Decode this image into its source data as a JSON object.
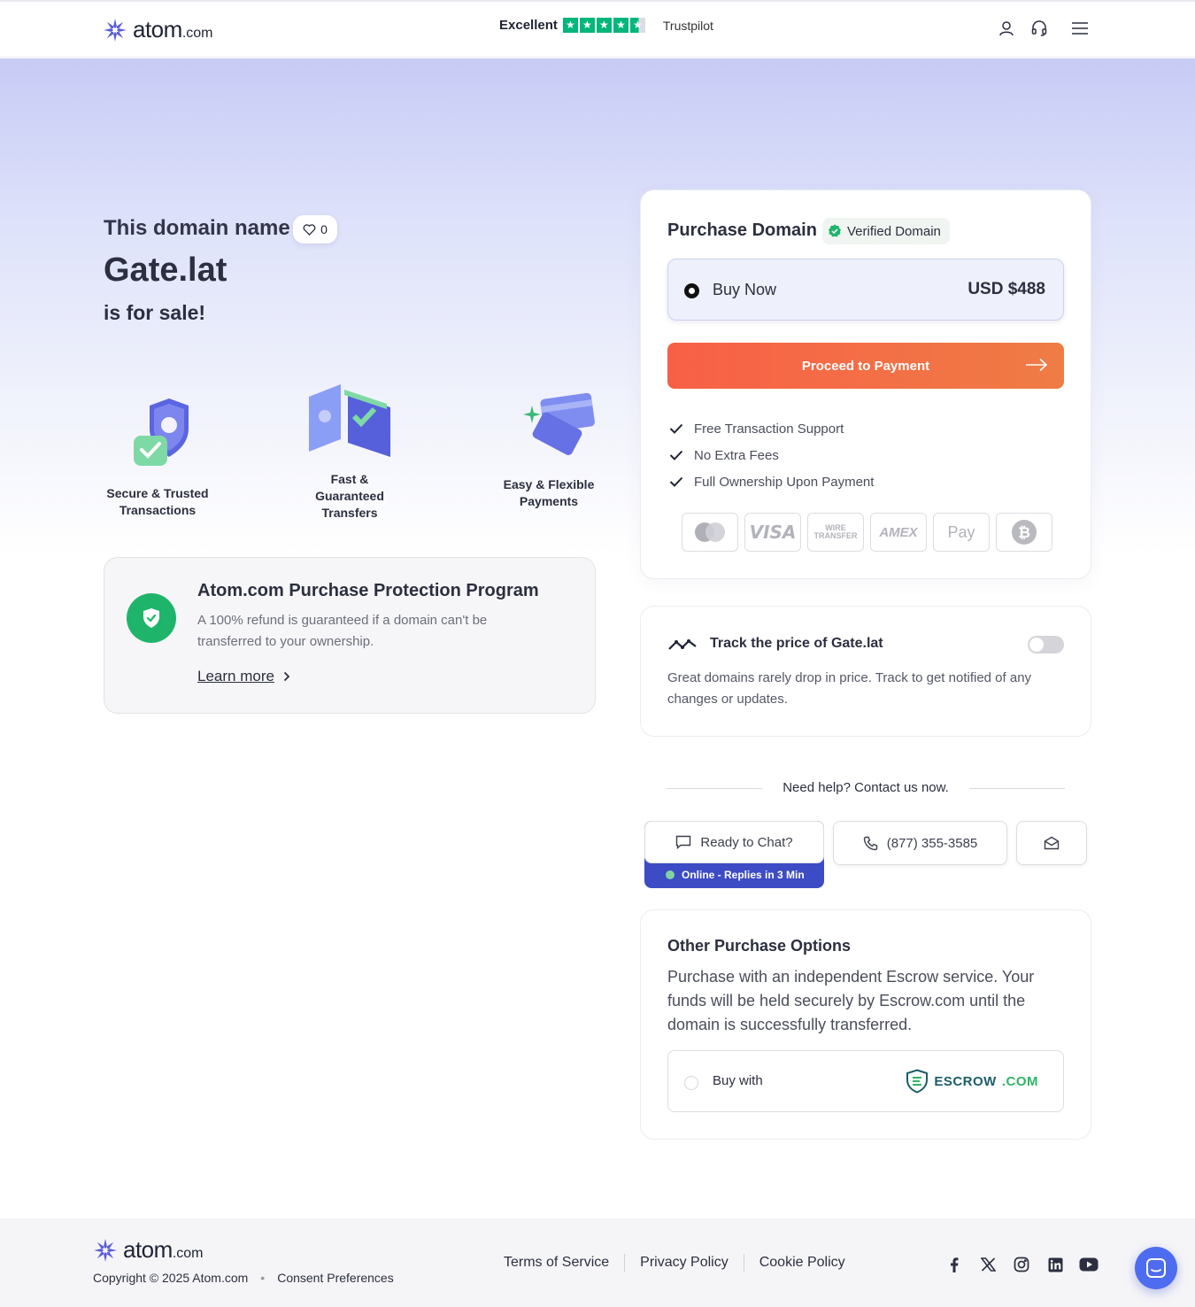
{
  "header": {
    "logo_text": "atom",
    "logo_suffix": ".com",
    "trust_label": "Excellent",
    "trust_brand": "Trustpilot",
    "rating_stars": 4.5,
    "icons": [
      "user-icon",
      "headset-icon",
      "menu-icon"
    ]
  },
  "hero": {
    "intro": "This domain name",
    "likes": "0",
    "domain": "Gate.lat",
    "for_sale": "is for sale!"
  },
  "features": [
    {
      "label": "Secure & Trusted Transactions"
    },
    {
      "label": "Fast & Guaranteed Transfers"
    },
    {
      "label": "Easy & Flexible Payments"
    }
  ],
  "protection": {
    "title": "Atom.com Purchase Protection Program",
    "desc": "A 100% refund is guaranteed if a domain can't be transferred to your ownership.",
    "link": "Learn more"
  },
  "purchase": {
    "title": "Purchase Domain",
    "verified": "Verified Domain",
    "option_label": "Buy Now",
    "price": "USD $488",
    "cta": "Proceed to Payment",
    "benefits": [
      "Free Transaction Support",
      "No Extra Fees",
      "Full Ownership Upon Payment"
    ],
    "payment_methods": [
      "Mastercard",
      "VISA",
      "WIRE TRANSFER",
      "AMEX",
      "Apple Pay",
      "Bitcoin"
    ]
  },
  "track": {
    "title": "Track the price of Gate.lat",
    "desc": "Great domains rarely drop in price. Track to get notified of any changes or updates.",
    "enabled": false
  },
  "help": {
    "text": "Need help? Contact us now.",
    "chat_label": "Ready to Chat?",
    "online_status": "Online - Replies in 3 Min",
    "phone": "(877) 355-3585"
  },
  "other": {
    "title": "Other Purchase Options",
    "desc": "Purchase with an independent Escrow service. Your funds will be held securely by Escrow.com until the domain is successfully transferred.",
    "option_label": "Buy with",
    "escrow_brand": "ESCROW",
    "escrow_suffix": ".COM"
  },
  "footer": {
    "logo_text": "atom",
    "logo_suffix": ".com",
    "copyright": "Copyright © 2025 Atom.com",
    "consent": "Consent Preferences",
    "links": [
      "Terms of Service",
      "Privacy Policy",
      "Cookie Policy"
    ],
    "socials": [
      "facebook-icon",
      "x-icon",
      "instagram-icon",
      "linkedin-icon",
      "youtube-icon"
    ]
  },
  "colors": {
    "brand": "#5a5fd6",
    "cta_start": "#f86046",
    "cta_end": "#ef7c45",
    "success": "#1eb56a",
    "trustpilot": "#00b67a"
  }
}
